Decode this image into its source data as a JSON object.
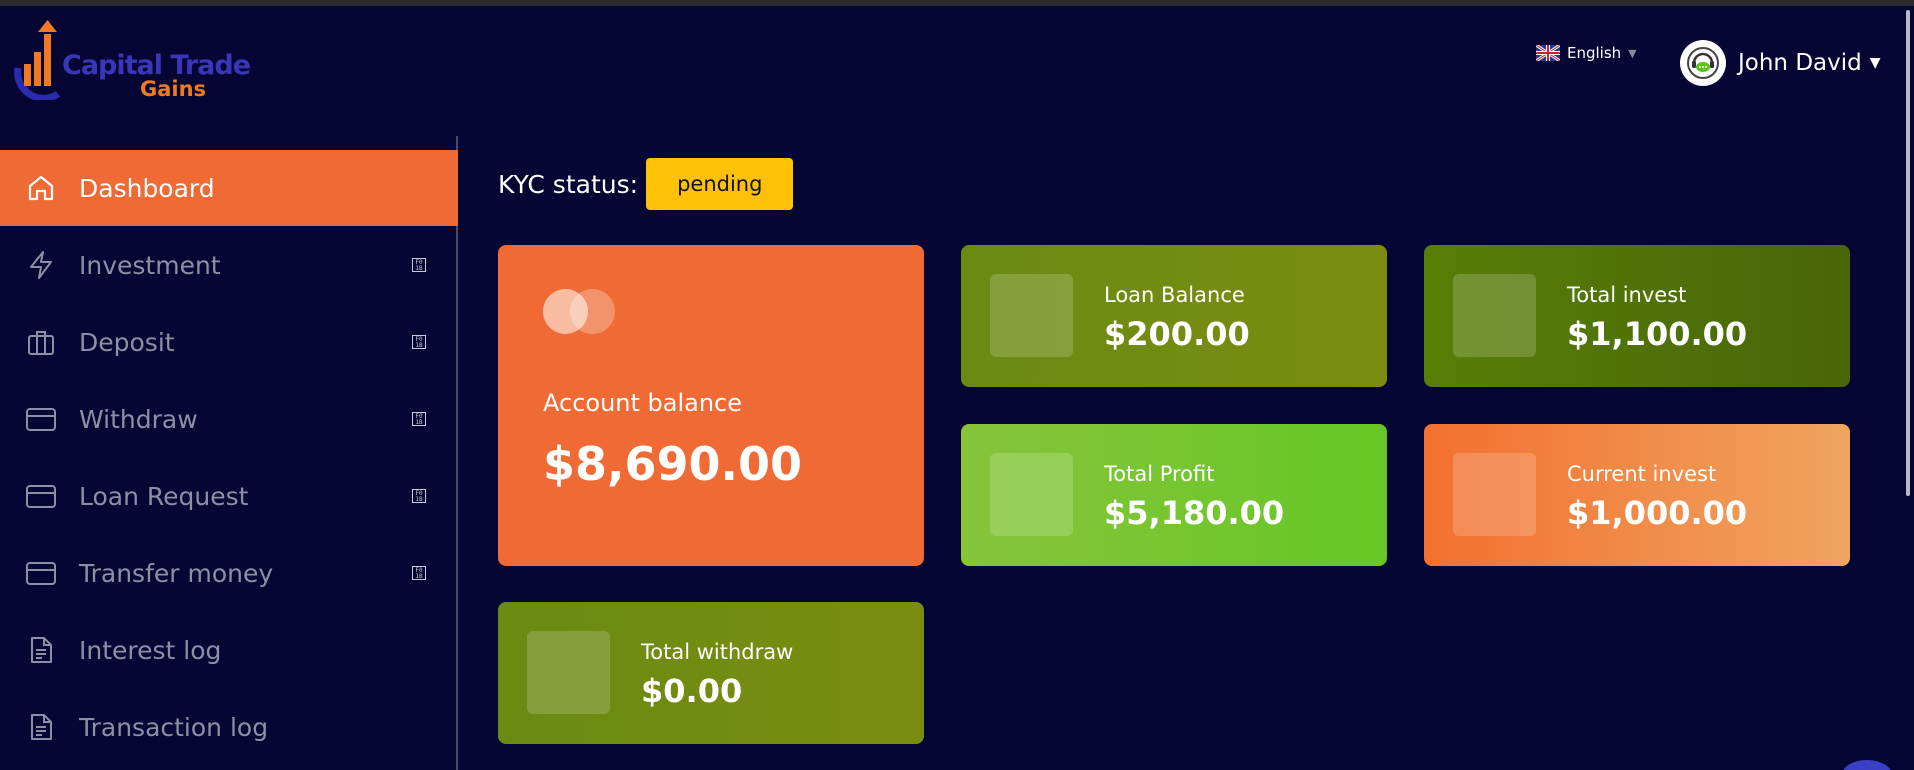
{
  "brand": {
    "line1": "Capital Trade",
    "line2": "Gains"
  },
  "header": {
    "language": "English",
    "user_name": "John David"
  },
  "sidebar": {
    "items": [
      {
        "label": "Dashboard",
        "icon": "home-icon",
        "active": true
      },
      {
        "label": "Investment",
        "icon": "lightning-icon",
        "badge": "F0 1B"
      },
      {
        "label": "Deposit",
        "icon": "briefcase-icon",
        "badge": "F0 1B"
      },
      {
        "label": "Withdraw",
        "icon": "card-icon",
        "badge": "F0 1B"
      },
      {
        "label": "Loan Request",
        "icon": "card-icon",
        "badge": "F0 1B"
      },
      {
        "label": "Transfer money",
        "icon": "card-icon",
        "badge": "F0 1B"
      },
      {
        "label": "Interest log",
        "icon": "document-icon"
      },
      {
        "label": "Transaction log",
        "icon": "document-icon"
      }
    ]
  },
  "kyc": {
    "label": "KYC status:",
    "status": "pending"
  },
  "cards": {
    "balance": {
      "label": "Account balance",
      "value": "$8,690.00"
    },
    "loan": {
      "label": "Loan Balance",
      "value": "$200.00"
    },
    "total_invest": {
      "label": "Total invest",
      "value": "$1,100.00"
    },
    "total_profit": {
      "label": "Total Profit",
      "value": "$5,180.00"
    },
    "current_invest": {
      "label": "Current invest",
      "value": "$1,000.00"
    },
    "total_withdraw": {
      "label": "Total withdraw",
      "value": "$0.00"
    }
  },
  "colors": {
    "background": "#050633",
    "accent": "#f06a35",
    "kyc_badge": "#ffc107"
  }
}
